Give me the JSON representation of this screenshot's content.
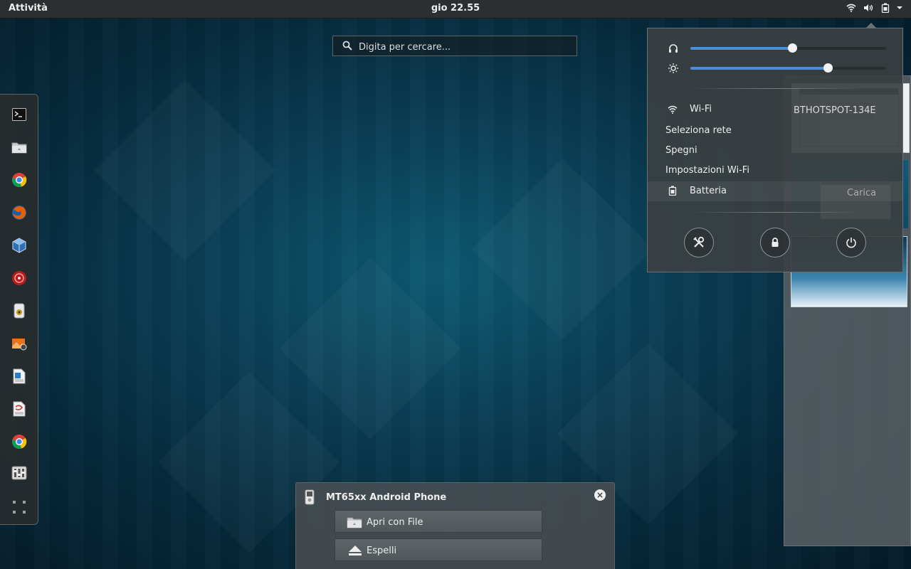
{
  "topbar": {
    "activities": "Attività",
    "clock": "gio 22.55",
    "tray_icons": [
      "wifi-icon",
      "volume-icon",
      "battery-icon",
      "dropdown-arrow-icon"
    ]
  },
  "search": {
    "placeholder": "Digita per cercare..."
  },
  "dash": {
    "apps": [
      "terminal-icon",
      "files-icon",
      "chrome-icon",
      "firefox-icon",
      "virtualbox-icon",
      "ruby-icon",
      "ipod-icon",
      "photos-icon",
      "writer-icon",
      "document-viewer-icon",
      "chrome-icon",
      "mixer-icon",
      "show-apps-icon"
    ]
  },
  "notification": {
    "title": "MT65xx Android Phone",
    "open_button": "Apri con File",
    "eject_button": "Espelli"
  },
  "system_menu": {
    "volume_level": 0.52,
    "brightness_level": 0.7,
    "wifi_label": "Wi-Fi",
    "wifi_ssid": "BTHOTSPOT-134E",
    "select_network": "Seleziona rete",
    "turn_off": "Spegni",
    "wifi_settings": "Impostazioni Wi-Fi",
    "battery_label": "Batteria",
    "battery_status": "Carica",
    "buttons": [
      "settings-icon",
      "lock-icon",
      "power-icon"
    ]
  }
}
